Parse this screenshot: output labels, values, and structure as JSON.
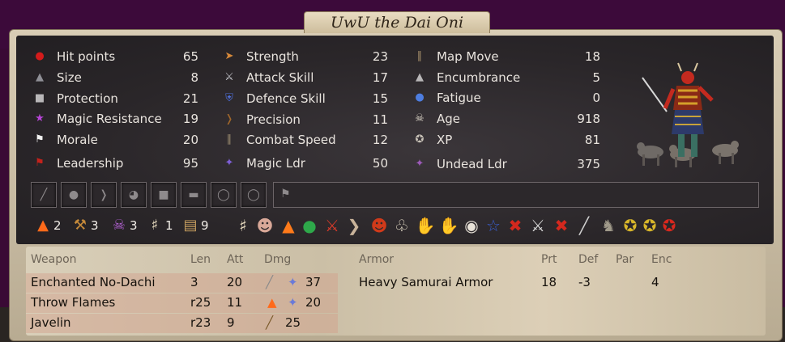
{
  "title": "UwU the Dai Oni",
  "stats_col1": [
    {
      "icon": "blood-drop-icon",
      "label": "Hit points",
      "value": "65"
    },
    {
      "icon": "creature-size-icon",
      "label": "Size",
      "value": "8"
    },
    {
      "icon": "armor-icon",
      "label": "Protection",
      "value": "21"
    },
    {
      "icon": "pentagram-icon",
      "label": "Magic Resistance",
      "value": "19"
    },
    {
      "icon": "white-flag-icon",
      "label": "Morale",
      "value": "20"
    },
    {
      "icon": "red-banner-icon",
      "label": "Leadership",
      "value": "95"
    }
  ],
  "stats_col2": [
    {
      "icon": "arm-icon",
      "label": "Strength",
      "value": "23"
    },
    {
      "icon": "sword-icon",
      "label": "Attack Skill",
      "value": "17"
    },
    {
      "icon": "shield-icon",
      "label": "Defence Skill",
      "value": "15"
    },
    {
      "icon": "bow-icon",
      "label": "Precision",
      "value": "11"
    },
    {
      "icon": "boots-icon",
      "label": "Combat Speed",
      "value": "12"
    },
    {
      "icon": "magic-star-icon",
      "label": "Magic Ldr",
      "value": "50"
    }
  ],
  "stats_col3": [
    {
      "icon": "boot-icon",
      "label": "Map Move",
      "value": "18"
    },
    {
      "icon": "weight-icon",
      "label": "Encumbrance",
      "value": "5"
    },
    {
      "icon": "water-drop-icon",
      "label": "Fatigue",
      "value": "0"
    },
    {
      "icon": "skull-icon",
      "label": "Age",
      "value": "918"
    },
    {
      "icon": "xp-star-icon",
      "label": "XP",
      "value": "81"
    },
    {
      "icon": "undead-icon",
      "label": "Undead Ldr",
      "value": "375"
    }
  ],
  "abilities": [
    {
      "icon": "fire-icon",
      "count": "2"
    },
    {
      "icon": "hammer-icon",
      "count": "3"
    },
    {
      "icon": "death-skull-icon",
      "count": "3"
    },
    {
      "icon": "candelabra-icon",
      "count": "1"
    },
    {
      "icon": "scroll-icon",
      "count": "9"
    }
  ],
  "weapons_header": {
    "name": "Weapon",
    "len": "Len",
    "att": "Att",
    "dmg": "Dmg"
  },
  "armor_header": {
    "name": "Armor",
    "prt": "Prt",
    "def": "Def",
    "par": "Par",
    "enc": "Enc"
  },
  "weapons": [
    {
      "name": "Enchanted No-Dachi",
      "len": "3",
      "att": "20",
      "dmg": "37"
    },
    {
      "name": "Throw Flames",
      "len": "r25",
      "att": "11",
      "dmg": "20"
    },
    {
      "name": "Javelin",
      "len": "r23",
      "att": "9",
      "dmg": "25"
    }
  ],
  "armors": [
    {
      "name": "Heavy Samurai Armor",
      "prt": "18",
      "def": "-3",
      "par": "",
      "enc": "4"
    }
  ]
}
